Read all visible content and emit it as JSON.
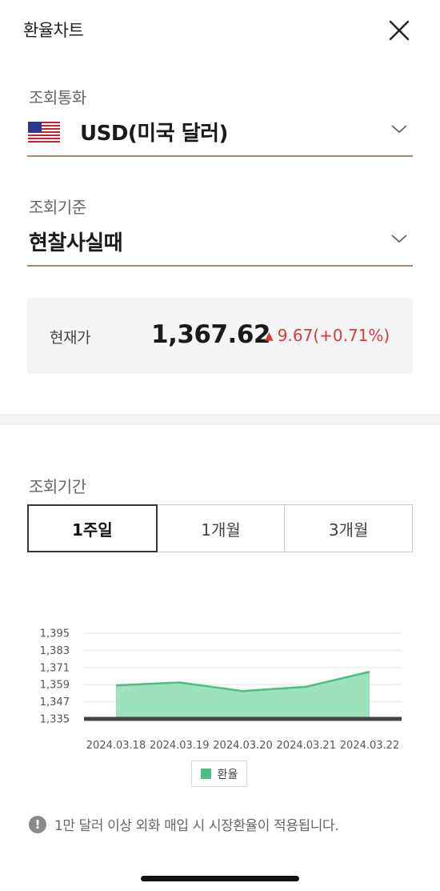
{
  "header": {
    "title": "환율차트",
    "close_icon": "close-icon"
  },
  "currency": {
    "label": "조회통화",
    "value": "USD(미국 달러)",
    "flag_icon": "us-flag-icon"
  },
  "basis": {
    "label": "조회기준",
    "value": "현찰사실때"
  },
  "current": {
    "label": "현재가",
    "price": "1,367.62",
    "change": "9.67(+0.71%)",
    "direction": "up",
    "change_color": "#d83b3b"
  },
  "period": {
    "label": "조회기간",
    "tabs": [
      {
        "label": "1주일",
        "selected": true
      },
      {
        "label": "1개월",
        "selected": false
      },
      {
        "label": "3개월",
        "selected": false
      }
    ]
  },
  "chart_data": {
    "type": "area",
    "x": [
      "2024.03.18",
      "2024.03.19",
      "2024.03.20",
      "2024.03.21",
      "2024.03.22"
    ],
    "series": [
      {
        "name": "환율",
        "values": [
          1358.5,
          1360.5,
          1354.5,
          1357.5,
          1368.0
        ],
        "color": "#4cbe83",
        "fill": "#9be2bd"
      }
    ],
    "y_ticks": [
      "1,395",
      "1,383",
      "1,371",
      "1,359",
      "1,347",
      "1,335"
    ],
    "ylim": [
      1335,
      1395
    ],
    "grid": true,
    "legend": "bottom-center"
  },
  "notice": {
    "icon": "info-icon",
    "text": "1만 달러 이상 외화 매입 시 시장환율이 적용됩니다."
  }
}
